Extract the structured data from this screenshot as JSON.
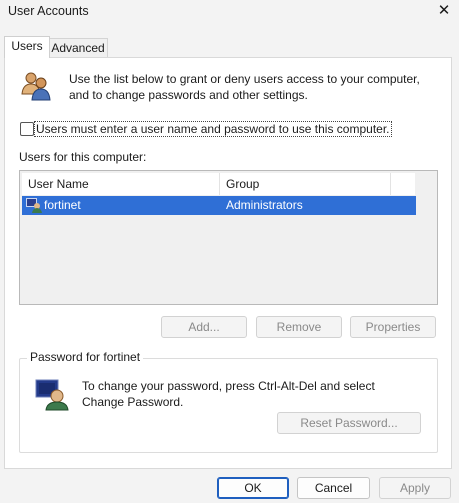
{
  "window": {
    "title": "User Accounts"
  },
  "tabs": [
    {
      "label": "Users",
      "selected": true
    },
    {
      "label": "Advanced",
      "selected": false
    }
  ],
  "intro_text": "Use the list below to grant or deny users access to your computer, and to change passwords and other settings.",
  "require_login": {
    "label": "Users must enter a user name and password to use this computer.",
    "checked": false
  },
  "users_list": {
    "label": "Users for this computer:",
    "columns": [
      "User Name",
      "Group"
    ],
    "rows": [
      {
        "user_name": "fortinet",
        "group": "Administrators",
        "selected": true
      }
    ]
  },
  "user_buttons": {
    "add": "Add...",
    "remove": "Remove",
    "properties": "Properties"
  },
  "password_group": {
    "title": "Password for fortinet",
    "text": "To change your password, press Ctrl-Alt-Del and select Change Password.",
    "reset_button": "Reset Password..."
  },
  "dialog_buttons": {
    "ok": "OK",
    "cancel": "Cancel",
    "apply": "Apply"
  },
  "colors": {
    "selection": "#2f6fd6",
    "default_button_border": "#1f5fbf",
    "window_bg": "#f3f3f3"
  }
}
